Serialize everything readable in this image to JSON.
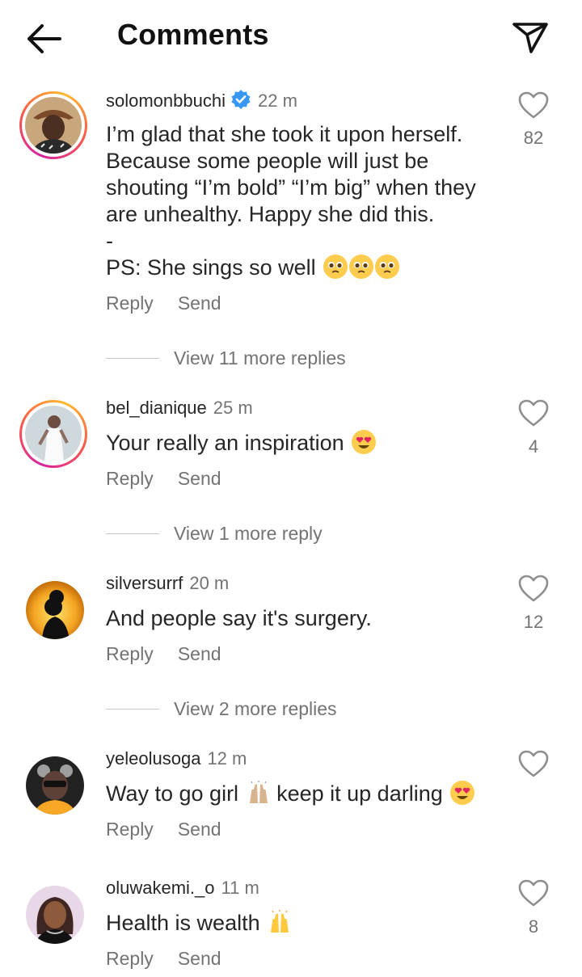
{
  "header": {
    "title": "Comments"
  },
  "colors": {
    "verified": "#3897f0",
    "secondary_text": "#737373",
    "ring_start": "#d6249f",
    "ring_end": "#fdbb2d"
  },
  "comments": [
    {
      "username": "solomonbbuchi",
      "verified": true,
      "time": "22 m",
      "lines": [
        "I’m glad that she took it upon herself.",
        "Because some people will just be",
        "shouting “I’m bold” “I’m big” when they",
        "are unhealthy. Happy she did this.",
        "-",
        "PS: She sings so well"
      ],
      "emoji": [
        "pleading-face",
        "pleading-face",
        "pleading-face"
      ],
      "likes": "82",
      "reply_label": "Reply",
      "send_label": "Send",
      "view_replies": "View 11 more replies"
    },
    {
      "username": "bel_dianique",
      "time": "25 m",
      "text": "Your really an inspiration",
      "emoji": [
        "heart-eyes-face"
      ],
      "likes": "4",
      "reply_label": "Reply",
      "send_label": "Send",
      "view_replies": "View 1 more reply"
    },
    {
      "username": "silversurrf",
      "time": "20 m",
      "text": "And people say it's surgery.",
      "likes": "12",
      "reply_label": "Reply",
      "send_label": "Send",
      "view_replies": "View 2 more replies"
    },
    {
      "username": "yeleolusoga",
      "time": "12 m",
      "text_a": "Way to go girl",
      "text_b": "keep it up darling",
      "emoji": [
        "raised-hands",
        "heart-eyes-face"
      ],
      "reply_label": "Reply",
      "send_label": "Send"
    },
    {
      "username": "oluwakemi._o",
      "time": "11 m",
      "text": "Health is wealth",
      "emoji": [
        "raised-hands"
      ],
      "likes": "8",
      "reply_label": "Reply",
      "send_label": "Send"
    }
  ]
}
